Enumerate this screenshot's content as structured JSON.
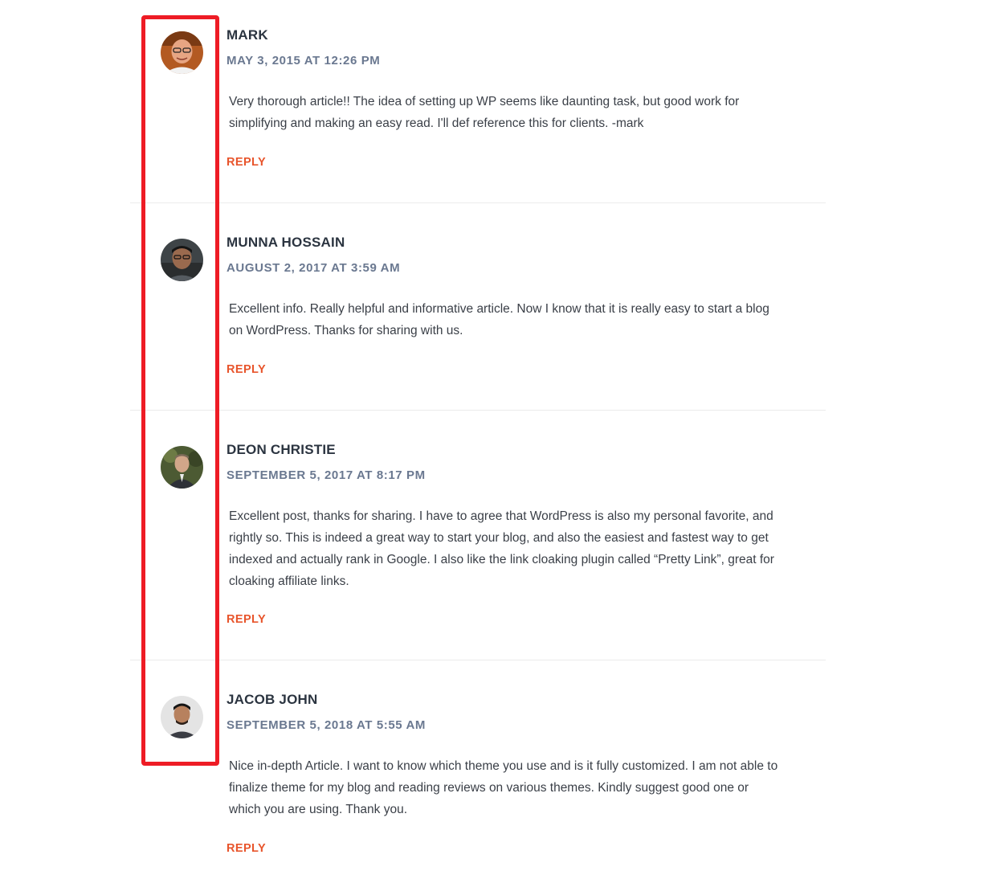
{
  "comments": [
    {
      "author": "MARK",
      "date": "MAY 3, 2015 AT 12:26 PM",
      "text": "Very thorough article!! The idea of setting up WP seems like daunting task, but good work for simplifying and making an easy read. I'll def reference this for clients. -mark",
      "reply": "REPLY"
    },
    {
      "author": "MUNNA HOSSAIN",
      "date": "AUGUST 2, 2017 AT 3:59 AM",
      "text": "Excellent info. Really helpful and informative article. Now I know that it is really easy to start a blog on WordPress. Thanks for sharing with us.",
      "reply": "REPLY"
    },
    {
      "author": "DEON CHRISTIE",
      "date": "SEPTEMBER 5, 2017 AT 8:17 PM",
      "text": "Excellent post, thanks for sharing. I have to agree that WordPress is also my personal favorite, and rightly so. This is indeed a great way to start your blog, and also the easiest and fastest way to get indexed and actually rank in Google. I also like the link cloaking plugin called “Pretty Link”, great for cloaking affiliate links.",
      "reply": "REPLY"
    },
    {
      "author": "JACOB JOHN",
      "date": "SEPTEMBER 5, 2018 AT 5:55 AM",
      "text": "Nice in-depth Article. I want to know which theme you use and is it fully customized. I am not able to finalize theme for my blog and reading reviews on various themes. Kindly suggest good one or which you are using. Thank you.",
      "reply": "REPLY"
    }
  ],
  "colors": {
    "author": "#2b3440",
    "date": "#6a7890",
    "reply": "#e8552c",
    "highlight": "#ee1c25"
  },
  "icons": [
    "avatar-mark",
    "avatar-munna-hossain",
    "avatar-deon-christie",
    "avatar-jacob-john"
  ]
}
